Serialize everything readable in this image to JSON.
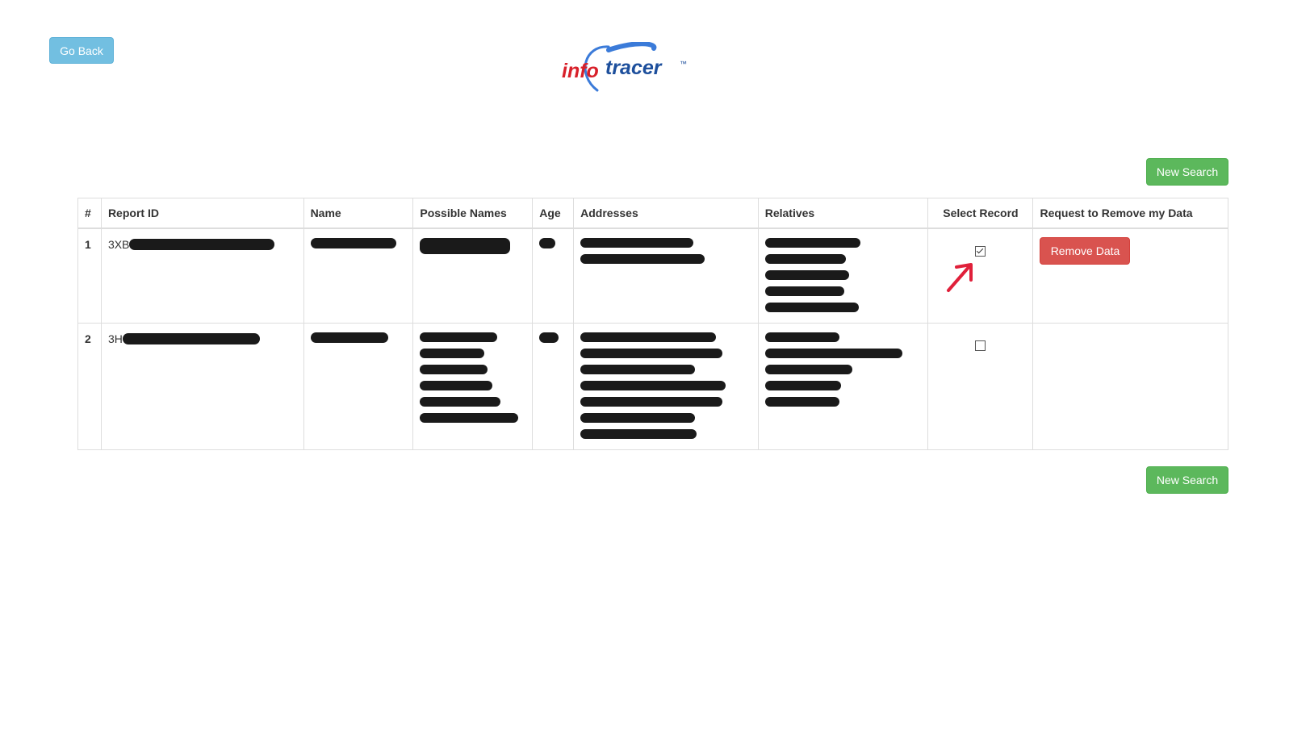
{
  "header": {
    "go_back_label": "Go Back",
    "logo": {
      "text_info": "info",
      "text_tracer": "tracer",
      "trademark": "™"
    }
  },
  "actions": {
    "new_search_top": "New Search",
    "new_search_bottom": "New Search"
  },
  "table": {
    "columns": [
      "#",
      "Report ID",
      "Name",
      "Possible Names",
      "Age",
      "Addresses",
      "Relatives",
      "Select Record",
      "Request to Remove my Data"
    ],
    "rows": [
      {
        "num": "1",
        "report_id_prefix": "3XB",
        "selected": true,
        "remove_label": "Remove Data"
      },
      {
        "num": "2",
        "report_id_prefix": "3H",
        "selected": false
      }
    ]
  },
  "colors": {
    "go_back": "#72bfe1",
    "new_search": "#5cb85c",
    "remove_data": "#d9534f",
    "annotation_arrow": "#e0203a",
    "logo_red": "#d8202a",
    "logo_blue": "#1d4f9c"
  },
  "icons": {
    "annotation": "red-arrow-icon",
    "checkbox_checked": "checkbox-checked-icon",
    "checkbox_empty": "checkbox-empty-icon"
  }
}
